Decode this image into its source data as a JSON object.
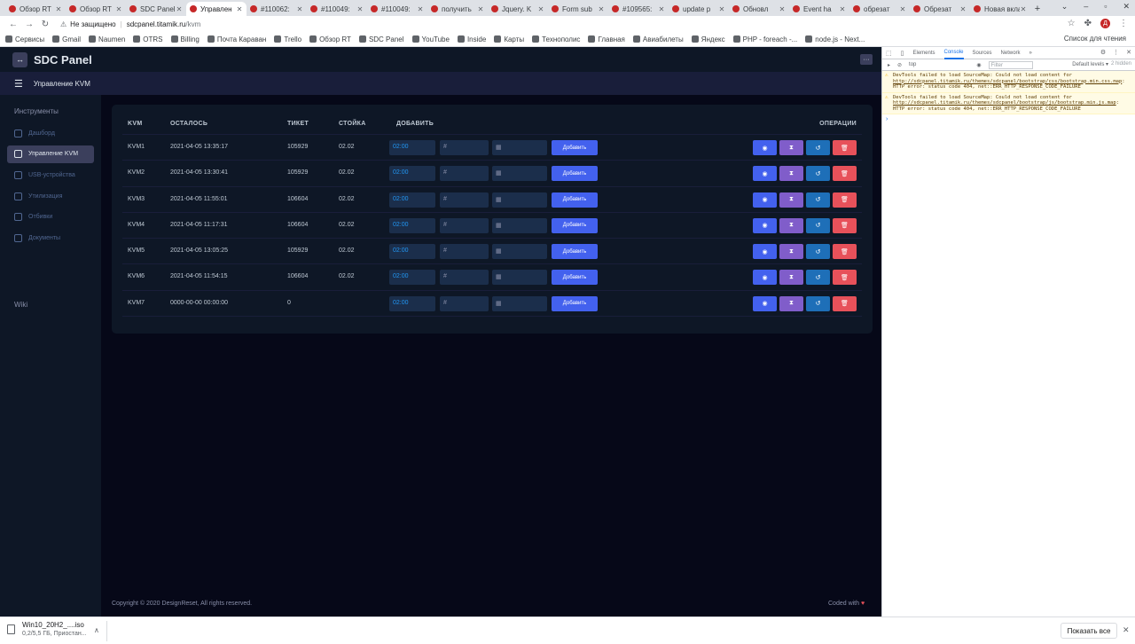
{
  "browser": {
    "tabs": [
      {
        "title": "Обзор RT",
        "active": false
      },
      {
        "title": "Обзор RT",
        "active": false
      },
      {
        "title": "SDC Panel",
        "active": false
      },
      {
        "title": "Управлен",
        "active": true
      },
      {
        "title": "#110062:",
        "active": false
      },
      {
        "title": "#110049:",
        "active": false
      },
      {
        "title": "#110049:",
        "active": false
      },
      {
        "title": "получить",
        "active": false
      },
      {
        "title": "Jquery. K",
        "active": false
      },
      {
        "title": "Form sub",
        "active": false
      },
      {
        "title": "#109565:",
        "active": false
      },
      {
        "title": "update p",
        "active": false
      },
      {
        "title": "Обновл",
        "active": false
      },
      {
        "title": "Event ha",
        "active": false
      },
      {
        "title": "обрезат",
        "active": false
      },
      {
        "title": "Обрезат",
        "active": false
      },
      {
        "title": "Новая вклад",
        "active": false
      }
    ],
    "new_tab": "+",
    "window_controls": [
      "⌄",
      "–",
      "▫",
      "✕"
    ],
    "security_label": "Не защищено",
    "url_host": "sdcpanel.titamik.ru",
    "url_path": "/kvm",
    "profile_initial": "Д",
    "bookmarks": [
      "Сервисы",
      "Gmail",
      "Naumen",
      "OTRS",
      "Billing",
      "Почта Караван",
      "Trello",
      "Обзор RT",
      "SDC Panel",
      "YouTube",
      "Inside",
      "Карты",
      "Технополис",
      "Главная",
      "Авиабилеты",
      "Яндекс",
      "PHP - foreach -...",
      "node.js - Next..."
    ],
    "reading_list": "Список для чтения"
  },
  "app": {
    "brand": "SDC Panel",
    "logo_glyph": "↔",
    "topbar_btn": "···",
    "subtitle": "Управление KVM",
    "sidebar": {
      "heading": "Инструменты",
      "items": [
        {
          "label": "Дашборд",
          "active": false
        },
        {
          "label": "Управление KVM",
          "active": true
        },
        {
          "label": "USB-устройства",
          "active": false
        },
        {
          "label": "Утилизация",
          "active": false
        },
        {
          "label": "Отбивки",
          "active": false
        },
        {
          "label": "Документы",
          "active": false
        }
      ],
      "wiki": "Wiki"
    },
    "table": {
      "headers": {
        "kvm": "KVM",
        "left": "ОСТАЛОСЬ",
        "ticket": "ТИКЕТ",
        "rack": "СТОЙКА",
        "add": "ДОБАВИТЬ",
        "ops": "ОПЕРАЦИИ"
      },
      "time_placeholder": "02:00",
      "hash_prefix": "#",
      "rack_prefix": "▦",
      "add_label": "Добавить",
      "rows": [
        {
          "kvm": "KVM1",
          "left": "2021-04-05 13:35:17",
          "ticket": "105929",
          "rack": "02.02"
        },
        {
          "kvm": "KVM2",
          "left": "2021-04-05 13:30:41",
          "ticket": "105929",
          "rack": "02.02"
        },
        {
          "kvm": "KVM3",
          "left": "2021-04-05 11:55:01",
          "ticket": "106604",
          "rack": "02.02"
        },
        {
          "kvm": "KVM4",
          "left": "2021-04-05 11:17:31",
          "ticket": "106604",
          "rack": "02.02"
        },
        {
          "kvm": "KVM5",
          "left": "2021-04-05 13:05:25",
          "ticket": "105929",
          "rack": "02.02"
        },
        {
          "kvm": "KVM6",
          "left": "2021-04-05 11:54:15",
          "ticket": "106604",
          "rack": "02.02"
        },
        {
          "kvm": "KVM7",
          "left": "0000-00-00 00:00:00",
          "ticket": "0",
          "rack": ""
        }
      ],
      "op_icons": {
        "view": "◉",
        "hour": "⧗",
        "reset": "↺",
        "del": "🗑"
      }
    },
    "footer_left": "Copyright © 2020 DesignReset, All rights reserved.",
    "footer_right": "Coded with",
    "heart": "♥"
  },
  "devtools": {
    "tabs": [
      "Elements",
      "Console",
      "Sources",
      "Network",
      "»"
    ],
    "context": "top",
    "filter_placeholder": "Filter",
    "levels": "Default levels ▾",
    "hidden": "2 hidden",
    "messages": [
      {
        "prefix": "DevTools failed to load SourceMap: Could not load content for ",
        "link": "http://sdcpanel.titamik.ru/themes/sdcpanel/bootstrap/css/bootstrap.min.css.map",
        "suffix": ": HTTP error: status code 404, net::ERR_HTTP_RESPONSE_CODE_FAILURE"
      },
      {
        "prefix": "DevTools failed to load SourceMap: Could not load content for ",
        "link": "http://sdcpanel.titamik.ru/themes/sdcpanel/bootstrap/js/bootstrap.min.js.map",
        "suffix": ": HTTP error: status code 404, net::ERR_HTTP_RESPONSE_CODE_FAILURE"
      }
    ],
    "prompt": "›"
  },
  "downloads": {
    "file": "Win10_20H2_....iso",
    "status": "0,2/5,5 ГБ, Приостан...",
    "chevron": "∧",
    "show_all": "Показать все",
    "close": "✕"
  }
}
